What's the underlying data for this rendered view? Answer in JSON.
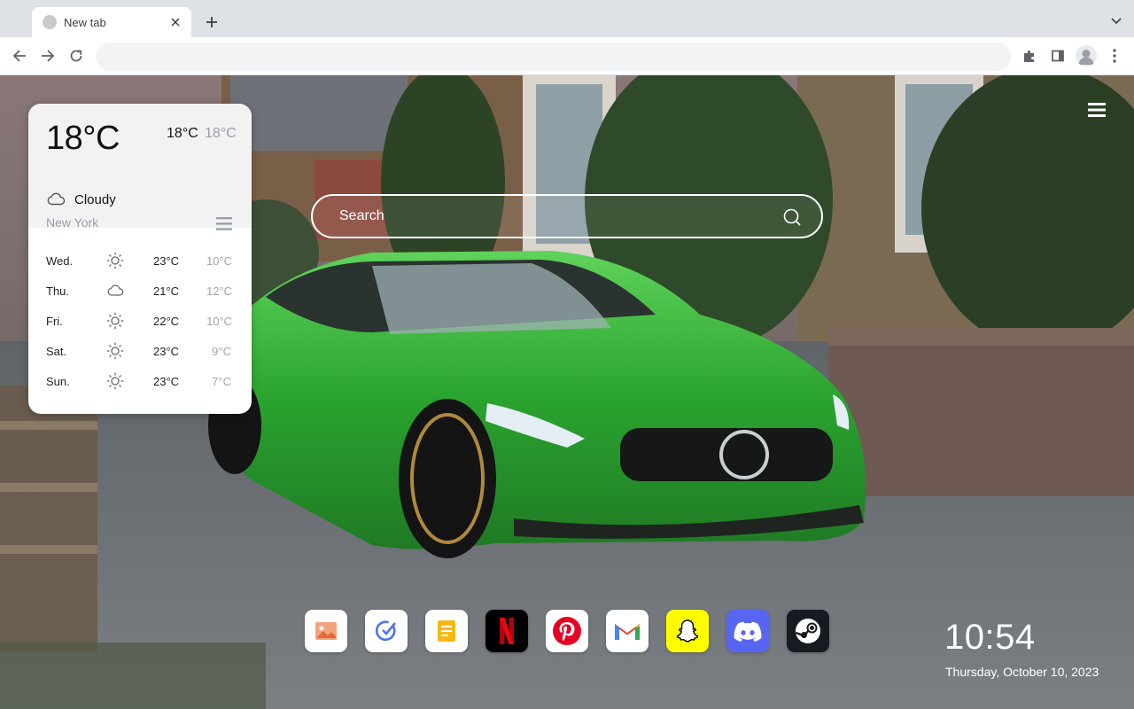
{
  "browser": {
    "tab_title": "New tab",
    "omnibox_value": "",
    "omnibox_placeholder": ""
  },
  "weather": {
    "current_temp": "18°C",
    "high": "18°C",
    "low": "18°C",
    "condition": "Cloudy",
    "condition_icon": "cloud-icon",
    "city": "New York",
    "forecast": [
      {
        "day": "Wed.",
        "icon": "sun-icon",
        "high": "23°C",
        "low": "10°C"
      },
      {
        "day": "Thu.",
        "icon": "cloud-icon",
        "high": "21°C",
        "low": "12°C"
      },
      {
        "day": "Fri.",
        "icon": "sun-icon",
        "high": "22°C",
        "low": "10°C"
      },
      {
        "day": "Sat.",
        "icon": "sun-icon",
        "high": "23°C",
        "low": "9°C"
      },
      {
        "day": "Sun.",
        "icon": "sun-icon",
        "high": "23°C",
        "low": "7°C"
      }
    ]
  },
  "search": {
    "placeholder": "Search"
  },
  "dock": [
    {
      "name": "Photos",
      "icon": "photos-icon",
      "color": "#ffffff"
    },
    {
      "name": "Tasks",
      "icon": "tasks-icon",
      "color": "#ffffff"
    },
    {
      "name": "Notes",
      "icon": "notes-icon",
      "color": "#ffffff"
    },
    {
      "name": "Netflix",
      "icon": "netflix-icon",
      "color": "#000000"
    },
    {
      "name": "Pinterest",
      "icon": "pinterest-icon",
      "color": "#ffffff"
    },
    {
      "name": "Gmail",
      "icon": "gmail-icon",
      "color": "#ffffff"
    },
    {
      "name": "Snapchat",
      "icon": "snapchat-icon",
      "color": "#fffc00"
    },
    {
      "name": "Discord",
      "icon": "discord-icon",
      "color": "#5865f2"
    },
    {
      "name": "Steam",
      "icon": "steam-icon",
      "color": "#171a21"
    }
  ],
  "clock": {
    "time": "10:54",
    "date": "Thursday, October 10, 2023"
  }
}
